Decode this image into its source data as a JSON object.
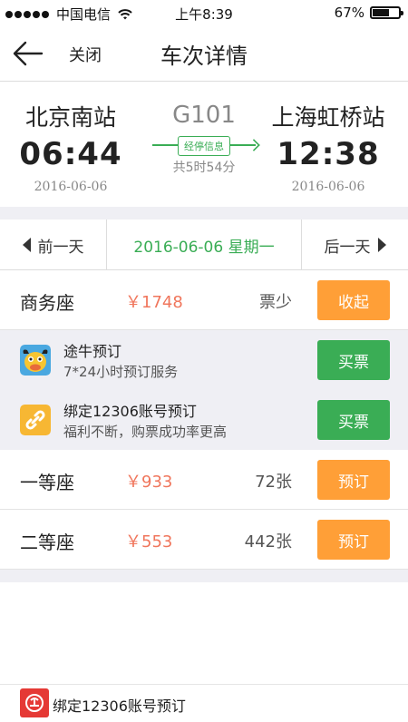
{
  "status": {
    "carrier": "中国电信",
    "time": "上午8:39",
    "battery": "67%",
    "battery_level": 0.67
  },
  "nav": {
    "close_label": "关闭",
    "title": "车次详情"
  },
  "journey": {
    "from_station": "北京南站",
    "from_time": "06:44",
    "from_date": "2016-06-06",
    "train_no": "G101",
    "stops_label": "经停信息",
    "duration": "共5时54分",
    "to_station": "上海虹桥站",
    "to_time": "12:38",
    "to_date": "2016-06-06"
  },
  "date_nav": {
    "prev": "前一天",
    "current": "2016-06-06 星期一",
    "next": "后一天"
  },
  "seats": [
    {
      "name": "商务座",
      "price": "￥1748",
      "availability": "票少",
      "action": "收起"
    },
    {
      "name": "一等座",
      "price": "￥933",
      "availability": "72张",
      "action": "预订"
    },
    {
      "name": "二等座",
      "price": "￥553",
      "availability": "442张",
      "action": "预订"
    }
  ],
  "booking_options": [
    {
      "title": "途牛预订",
      "subtitle": "7*24小时预订服务",
      "action": "买票",
      "icon": "tuniu-logo-icon"
    },
    {
      "title": "绑定12306账号预订",
      "subtitle": "福利不断，购票成功率更高",
      "action": "买票",
      "icon": "link-icon"
    }
  ],
  "bottom": {
    "label": "绑定12306账号预订",
    "icon": "railway-logo-icon"
  },
  "colors": {
    "green": "#3aad55",
    "orange": "#ff9f37",
    "price": "#f0765c",
    "gray_bg": "#efeff4"
  }
}
